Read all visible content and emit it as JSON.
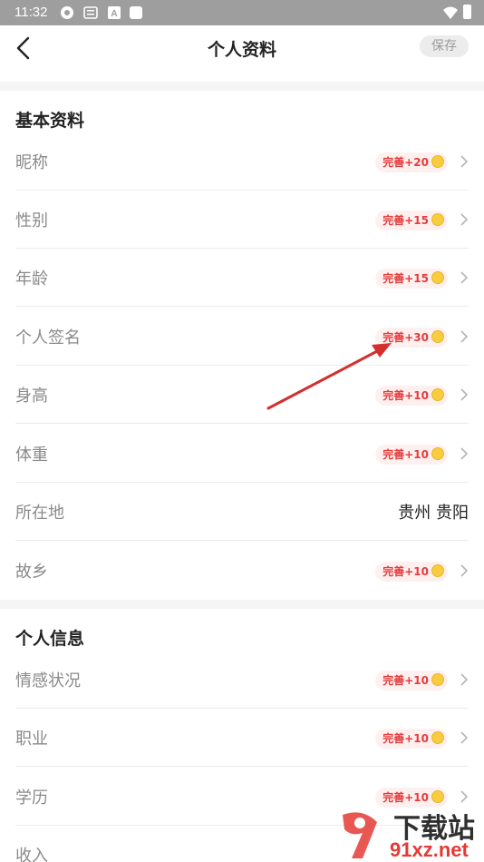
{
  "status_bar": {
    "time": "11:32",
    "icons": [
      "app-icon",
      "keyboard-icon",
      "a-icon",
      "square-icon",
      "wifi-icon",
      "battery-icon"
    ]
  },
  "header": {
    "title": "个人资料",
    "save_label": "保存"
  },
  "basic": {
    "title": "基本资料",
    "rows": [
      {
        "label": "昵称",
        "badge": "完善+20"
      },
      {
        "label": "性别",
        "badge": "完善+15"
      },
      {
        "label": "年龄",
        "badge": "完善+15"
      },
      {
        "label": "个人签名",
        "badge": "完善+30"
      },
      {
        "label": "身高",
        "badge": "完善+10"
      },
      {
        "label": "体重",
        "badge": "完善+10"
      },
      {
        "label": "所在地",
        "value": "贵州 贵阳"
      },
      {
        "label": "故乡",
        "badge": "完善+10"
      }
    ]
  },
  "personal": {
    "title": "个人信息",
    "rows": [
      {
        "label": "情感状况",
        "badge": "完善+10"
      },
      {
        "label": "职业",
        "badge": "完善+10"
      },
      {
        "label": "学历",
        "badge": "完善+10"
      },
      {
        "label": "收入"
      }
    ]
  },
  "watermark": {
    "brand": "下载站",
    "url": "91xz.net"
  },
  "colors": {
    "badge_text": "#e43c3c",
    "badge_bg": "#fff0f0",
    "coin": "#f7cc3e",
    "arrow": "#d32f2f"
  }
}
